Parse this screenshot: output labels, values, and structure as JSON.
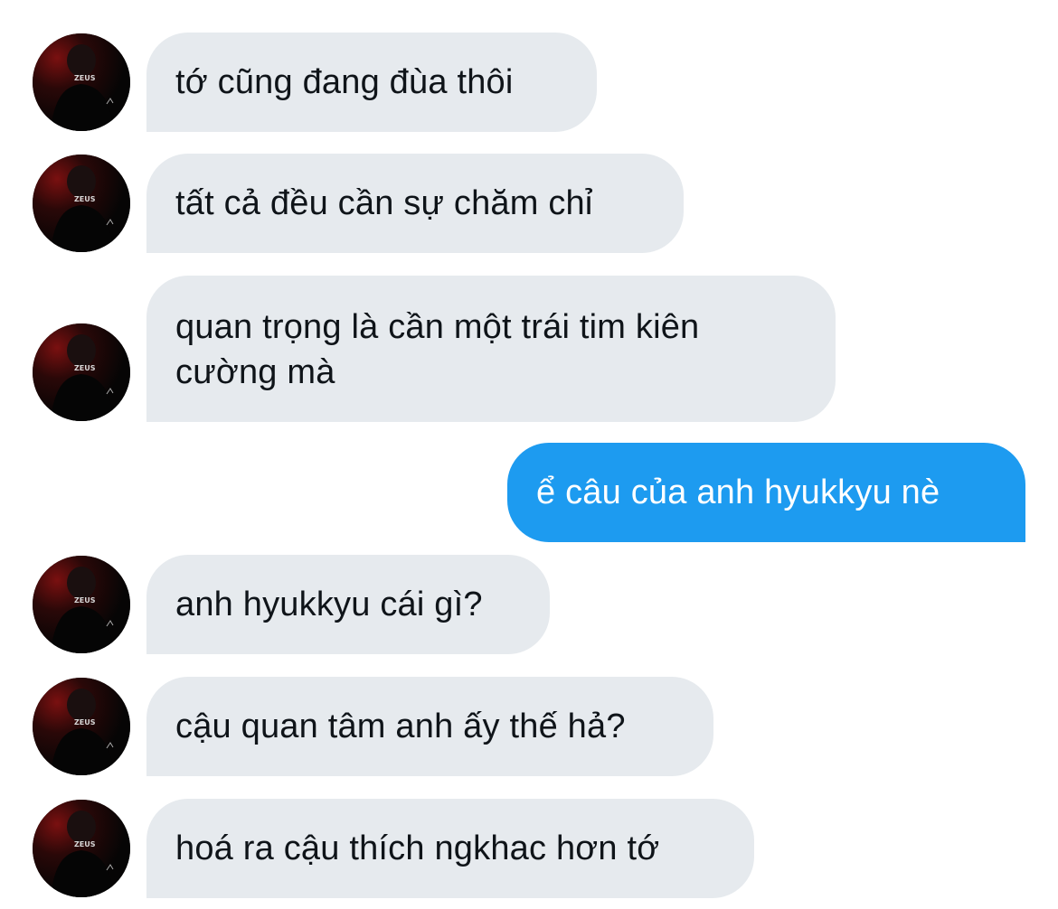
{
  "conversation": {
    "messages": [
      {
        "sender": "other",
        "text": "tớ cũng đang đùa thôi"
      },
      {
        "sender": "other",
        "text": "tất cả đều cần sự chăm chỉ"
      },
      {
        "sender": "other",
        "text": "quan trọng là cần một trái tim kiên cường mà"
      },
      {
        "sender": "me",
        "text": "ể câu của anh hyukkyu nè"
      },
      {
        "sender": "other",
        "text": "anh hyukkyu cái gì?"
      },
      {
        "sender": "other",
        "text": "cậu quan tâm anh ấy thế hả?"
      },
      {
        "sender": "other",
        "text": "hoá ra cậu thích ngkhac hơn tớ"
      }
    ]
  },
  "avatar": {
    "jersey_text": "ZEUS",
    "icon": "profile-photo-icon"
  },
  "colors": {
    "incoming_bubble": "#e6eaee",
    "outgoing_bubble": "#1d9bf0",
    "incoming_text": "#0f1419",
    "outgoing_text": "#ffffff"
  }
}
